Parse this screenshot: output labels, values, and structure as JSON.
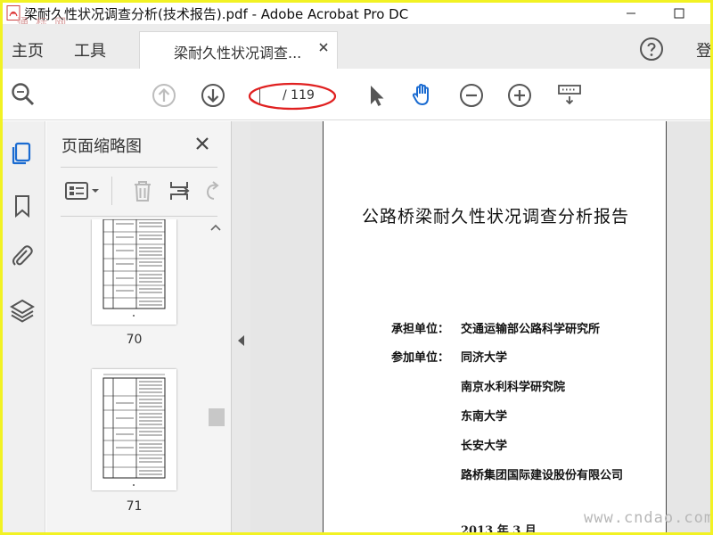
{
  "window": {
    "title": "梁耐久性状况调查分析(技术报告).pdf - Adobe Acrobat Pro DC",
    "watermark_top": "通 标 网",
    "watermark_bottom": "www.cndao.com"
  },
  "tabs": {
    "home": "主页",
    "tools": "工具",
    "document": "梁耐久性状况调查...",
    "signin": "登"
  },
  "toolbar": {
    "page_current": "",
    "page_total": "/ 119"
  },
  "thumbnail_panel": {
    "title": "页面缩略图",
    "thumbnails": [
      {
        "page_label": "70"
      },
      {
        "page_label": "71"
      }
    ]
  },
  "document": {
    "title": "公路桥梁耐久性状况调查分析报告",
    "undertaker_label": "承担单位：",
    "undertaker": "交通运输部公路科学研究所",
    "participants_label": "参加单位：",
    "participants": [
      "同济大学",
      "南京水利科学研究院",
      "东南大学",
      "长安大学",
      "路桥集团国际建设股份有限公司"
    ],
    "date": "2013 年 3 月"
  },
  "colors": {
    "frame_border": "#f2f223",
    "active_blue": "#1a6bd1",
    "annotation_red": "#e02020",
    "icon_gray": "#5a5a5a"
  }
}
